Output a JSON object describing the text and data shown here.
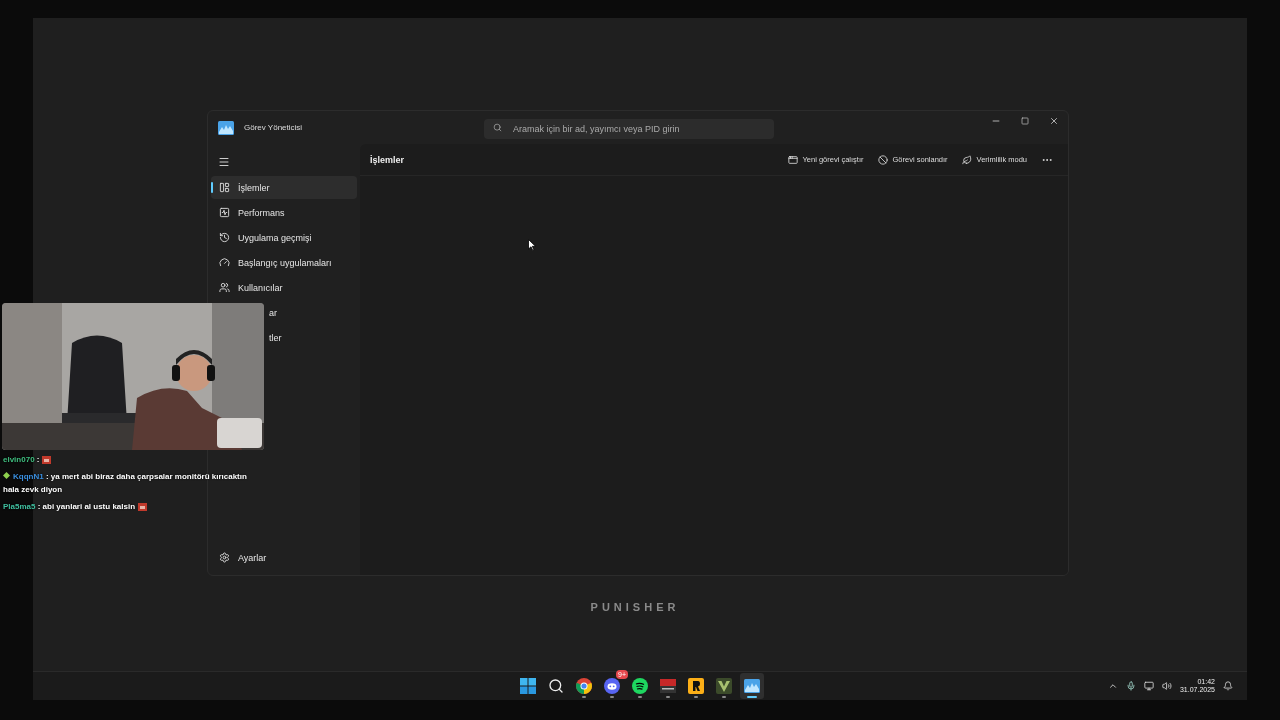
{
  "window": {
    "title": "Görev Yöneticisi",
    "search": {
      "placeholder": "Aramak için bir ad, yayımcı veya PID girin"
    }
  },
  "sidebar": {
    "items": [
      {
        "label": "İşlemler",
        "kind": "processes",
        "selected": true
      },
      {
        "label": "Performans",
        "kind": "performance",
        "selected": false
      },
      {
        "label": "Uygulama geçmişi",
        "kind": "history",
        "selected": false
      },
      {
        "label": "Başlangıç uygulamaları",
        "kind": "startup",
        "selected": false
      },
      {
        "label": "Kullanıcılar",
        "kind": "users",
        "selected": false
      }
    ],
    "partly_hidden_items": [
      "ar",
      "tler"
    ],
    "footer": {
      "label": "Ayarlar"
    }
  },
  "page": {
    "title": "İşlemler",
    "actions": [
      {
        "label": "Yeni görevi çalıştır",
        "kind": "new"
      },
      {
        "label": "Görevi sonlandır",
        "kind": "end"
      },
      {
        "label": "Verimlilik modu",
        "kind": "eco"
      }
    ]
  },
  "wallpaper_text": "PUNISHER",
  "taskbar": {
    "apps": [
      {
        "kind": "start",
        "running": false,
        "selected": false
      },
      {
        "kind": "search",
        "running": false,
        "selected": false
      },
      {
        "kind": "browser",
        "running": true,
        "selected": false
      },
      {
        "kind": "chat",
        "running": true,
        "selected": false,
        "badge": "9+"
      },
      {
        "kind": "music",
        "running": true,
        "selected": false
      },
      {
        "kind": "news",
        "running": true,
        "selected": false
      },
      {
        "kind": "rockstar",
        "running": true,
        "selected": false
      },
      {
        "kind": "game",
        "running": true,
        "selected": false
      },
      {
        "kind": "taskmgr",
        "running": true,
        "selected": true
      }
    ],
    "time": "01:42",
    "date": "31.07.2025"
  },
  "chat": [
    {
      "user": "elvin070",
      "color": "#3fbf7f",
      "text": ":",
      "badge": false,
      "emote": true
    },
    {
      "user": "KqqnN1",
      "color": "#3a8fe0",
      "text": ": ya mert abi biraz daha çarpsalar monitörü kırıcaktın hala zevk diyon",
      "badge": true,
      "emote": false
    },
    {
      "user": "Pla5ma5",
      "color": "#3fbf9f",
      "text": ": abi yanlari al ustu kalsin",
      "badge": false,
      "emote": true
    }
  ]
}
